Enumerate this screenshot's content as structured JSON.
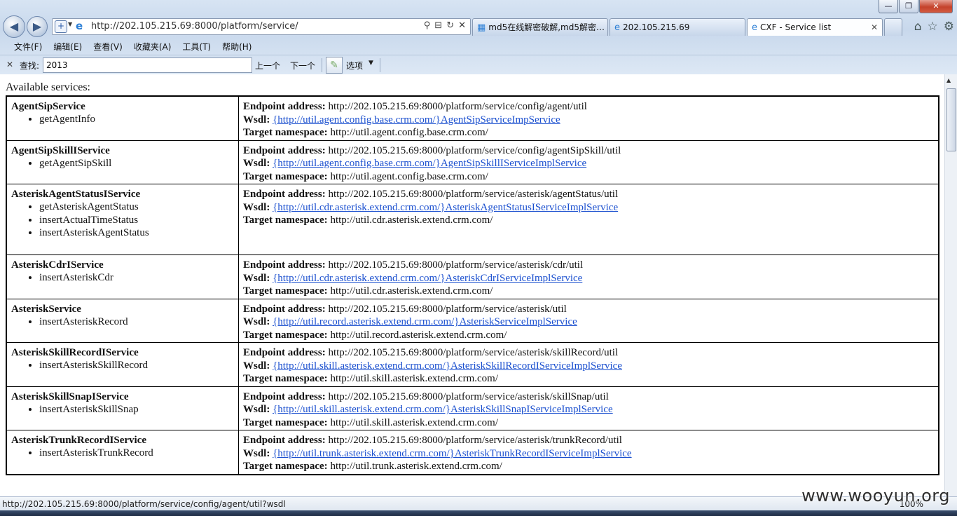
{
  "window": {
    "minimize": "—",
    "maximize": "❐",
    "close": "✕"
  },
  "address_bar": {
    "url": "http://202.105.215.69:8000/platform/service/",
    "compat_icon": "+",
    "search_icon": "⚲",
    "refresh_icon": "↻",
    "stop_icon": "✕"
  },
  "tabs": [
    {
      "label": "md5在线解密破解,md5解密…",
      "icon": "grid-icon",
      "active": false
    },
    {
      "label": "202.105.215.69",
      "icon": "ie-icon",
      "active": false
    },
    {
      "label": "CXF - Service list",
      "icon": "ie-icon",
      "active": true
    }
  ],
  "toolbar_icons": {
    "home": "⌂",
    "favorites": "☆",
    "settings": "⚙"
  },
  "menu": [
    "文件(F)",
    "编辑(E)",
    "查看(V)",
    "收藏夹(A)",
    "工具(T)",
    "帮助(H)"
  ],
  "find_bar": {
    "label": "查找:",
    "value": "2013",
    "prev": "上一个",
    "next": "下一个",
    "options": "选项"
  },
  "page": {
    "title": "Available services:",
    "labels": {
      "endpoint": "Endpoint address:",
      "wsdl": "Wsdl:",
      "namespace": "Target namespace:"
    },
    "services": [
      {
        "name": "AgentSipService",
        "operations": [
          "getAgentInfo"
        ],
        "endpoint": "http://202.105.215.69:8000/platform/service/config/agent/util",
        "wsdl": "{http://util.agent.config.base.crm.com/}AgentSipServiceImpService",
        "namespace": "http://util.agent.config.base.crm.com/"
      },
      {
        "name": "AgentSipSkillIService",
        "operations": [
          "getAgentSipSkill"
        ],
        "endpoint": "http://202.105.215.69:8000/platform/service/config/agentSipSkill/util",
        "wsdl": "{http://util.agent.config.base.crm.com/}AgentSipSkillIServiceImplService",
        "namespace": "http://util.agent.config.base.crm.com/"
      },
      {
        "name": "AsteriskAgentStatusIService",
        "operations": [
          "getAsteriskAgentStatus",
          "insertActualTimeStatus",
          "insertAsteriskAgentStatus"
        ],
        "endpoint": "http://202.105.215.69:8000/platform/service/asterisk/agentStatus/util",
        "wsdl": "{http://util.cdr.asterisk.extend.crm.com/}AsteriskAgentStatusIServiceImplService",
        "namespace": "http://util.cdr.asterisk.extend.crm.com/"
      },
      {
        "name": "AsteriskCdrIService",
        "operations": [
          "insertAsteriskCdr"
        ],
        "endpoint": "http://202.105.215.69:8000/platform/service/asterisk/cdr/util",
        "wsdl": "{http://util.cdr.asterisk.extend.crm.com/}AsteriskCdrIServiceImplService",
        "namespace": "http://util.cdr.asterisk.extend.crm.com/"
      },
      {
        "name": "AsteriskService",
        "operations": [
          "insertAsteriskRecord"
        ],
        "endpoint": "http://202.105.215.69:8000/platform/service/asterisk/util",
        "wsdl": "{http://util.record.asterisk.extend.crm.com/}AsteriskServiceImplService",
        "namespace": "http://util.record.asterisk.extend.crm.com/"
      },
      {
        "name": "AsteriskSkillRecordIService",
        "operations": [
          "insertAsteriskSkillRecord"
        ],
        "endpoint": "http://202.105.215.69:8000/platform/service/asterisk/skillRecord/util",
        "wsdl": "{http://util.skill.asterisk.extend.crm.com/}AsteriskSkillRecordIServiceImplService",
        "namespace": "http://util.skill.asterisk.extend.crm.com/"
      },
      {
        "name": "AsteriskSkillSnapIService",
        "operations": [
          "insertAsteriskSkillSnap"
        ],
        "endpoint": "http://202.105.215.69:8000/platform/service/asterisk/skillSnap/util",
        "wsdl": "{http://util.skill.asterisk.extend.crm.com/}AsteriskSkillSnapIServiceImplService",
        "namespace": "http://util.skill.asterisk.extend.crm.com/"
      },
      {
        "name": "AsteriskTrunkRecordIService",
        "operations": [
          "insertAsteriskTrunkRecord"
        ],
        "endpoint": "http://202.105.215.69:8000/platform/service/asterisk/trunkRecord/util",
        "wsdl": "{http://util.trunk.asterisk.extend.crm.com/}AsteriskTrunkRecordIServiceImplService",
        "namespace": "http://util.trunk.asterisk.extend.crm.com/"
      }
    ]
  },
  "status_bar": {
    "url": "http://202.105.215.69:8000/platform/service/config/agent/util?wsdl",
    "zoom": "100%"
  },
  "watermark": "www.wooyun.org",
  "colors": {
    "link": "#1a4fcf",
    "chrome": "#d7e4f3",
    "close_button": "#c4422c"
  }
}
